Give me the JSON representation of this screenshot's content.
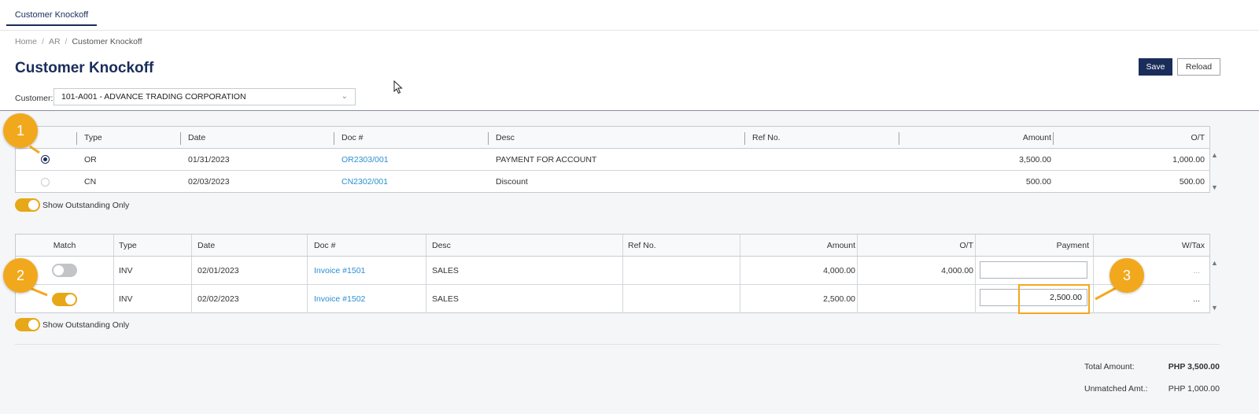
{
  "tab": {
    "label": "Customer Knockoff"
  },
  "breadcrumb": {
    "home": "Home",
    "sep": "/",
    "ar": "AR",
    "current": "Customer Knockoff"
  },
  "page": {
    "title": "Customer Knockoff"
  },
  "customer": {
    "label": "Customer:",
    "value": "101-A001 - ADVANCE TRADING CORPORATION"
  },
  "toolbar": {
    "save_label": "Save",
    "reload_label": "Reload"
  },
  "payments": {
    "headers": {
      "type": "Type",
      "date": "Date",
      "doc": "Doc #",
      "desc": "Desc",
      "ref": "Ref No.",
      "amount": "Amount",
      "ot": "O/T"
    },
    "rows": [
      {
        "selected": true,
        "type": "OR",
        "date": "01/31/2023",
        "doc": "OR2303/001",
        "desc": "PAYMENT FOR ACCOUNT",
        "ref": "",
        "amount": "3,500.00",
        "ot": "1,000.00"
      },
      {
        "selected": false,
        "type": "CN",
        "date": "02/03/2023",
        "doc": "CN2302/001",
        "desc": "Discount",
        "ref": "",
        "amount": "500.00",
        "ot": "500.00"
      }
    ],
    "show_outstanding": {
      "label": "Show Outstanding Only",
      "on": true
    }
  },
  "invoices": {
    "headers": {
      "match": "Match",
      "type": "Type",
      "date": "Date",
      "doc": "Doc #",
      "desc": "Desc",
      "ref": "Ref No.",
      "amount": "Amount",
      "ot": "O/T",
      "payment": "Payment",
      "wtax": "W/Tax"
    },
    "rows": [
      {
        "matched": false,
        "type": "INV",
        "date": "02/01/2023",
        "doc": "Invoice #1501",
        "desc": "SALES",
        "ref": "",
        "amount": "4,000.00",
        "ot": "4,000.00",
        "payment": "",
        "wtax": "..."
      },
      {
        "matched": true,
        "type": "INV",
        "date": "02/02/2023",
        "doc": "Invoice #1502",
        "desc": "SALES",
        "ref": "",
        "amount": "2,500.00",
        "ot": "",
        "payment": "2,500.00",
        "wtax": "..."
      }
    ],
    "show_outstanding": {
      "label": "Show Outstanding Only",
      "on": true
    }
  },
  "totals": {
    "total_label": "Total Amount:",
    "total_value": "PHP 3,500.00",
    "unmatched_label": "Unmatched Amt.:",
    "unmatched_value": "PHP 1,000.00"
  },
  "callouts": [
    "1",
    "2",
    "3"
  ],
  "colors": {
    "primary": "#1a2d5a",
    "accent": "#f2a81d",
    "toggle_on": "#e6a817",
    "link": "#2a8fd1"
  }
}
